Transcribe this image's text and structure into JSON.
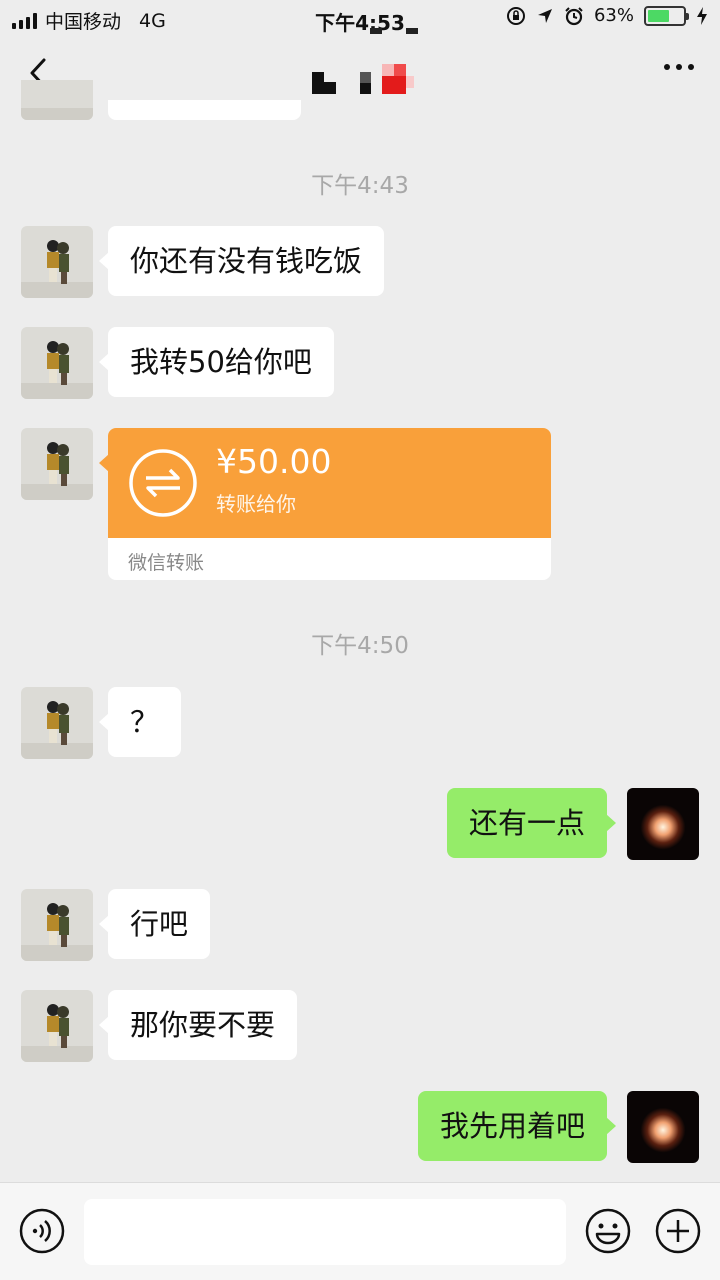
{
  "status_bar": {
    "carrier": "中国移动",
    "network": "4G",
    "time": "下午4:53",
    "battery_percent": "63%",
    "battery_level": 0.63,
    "icons": [
      "orientation-lock-icon",
      "location-icon",
      "alarm-icon",
      "charging-icon"
    ]
  },
  "nav": {
    "title_obscured": true,
    "back_icon": "chevron-left-icon",
    "more_icon": "more-dots-icon"
  },
  "messages": [
    {
      "type": "time",
      "text": "下午4:43"
    },
    {
      "type": "text",
      "side": "left",
      "text": "你还有没有钱吃饭"
    },
    {
      "type": "text",
      "side": "left",
      "text": "我转50给你吧"
    },
    {
      "type": "transfer",
      "side": "left",
      "amount": "¥50.00",
      "desc": "转账给你",
      "footer": "微信转账"
    },
    {
      "type": "time",
      "text": "下午4:50"
    },
    {
      "type": "text",
      "side": "left",
      "text": "？"
    },
    {
      "type": "text",
      "side": "right",
      "text": "还有一点"
    },
    {
      "type": "text",
      "side": "left",
      "text": "行吧"
    },
    {
      "type": "text",
      "side": "left",
      "text": "那你要不要"
    },
    {
      "type": "text",
      "side": "right",
      "text": "我先用着吧"
    }
  ],
  "input_bar": {
    "voice_icon": "voice-icon",
    "emoji_icon": "emoji-icon",
    "plus_icon": "plus-icon",
    "value": ""
  },
  "colors": {
    "background": "#ededed",
    "self_bubble": "#95ec69",
    "other_bubble": "#ffffff",
    "transfer": "#f9a03a",
    "timestamp": "#a8a8a8"
  }
}
